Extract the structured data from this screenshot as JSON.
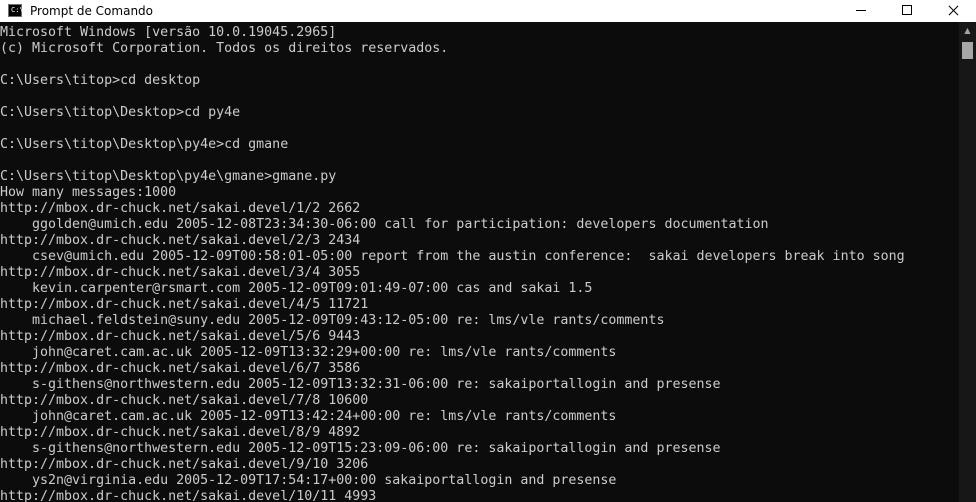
{
  "window": {
    "title": "Prompt de Comando",
    "icon_glyph": "C:\\"
  },
  "console": {
    "lines": [
      "Microsoft Windows [versão 10.0.19045.2965]",
      "(c) Microsoft Corporation. Todos os direitos reservados.",
      "",
      "C:\\Users\\titop>cd desktop",
      "",
      "C:\\Users\\titop\\Desktop>cd py4e",
      "",
      "C:\\Users\\titop\\Desktop\\py4e>cd gmane",
      "",
      "C:\\Users\\titop\\Desktop\\py4e\\gmane>gmane.py",
      "How many messages:1000",
      "http://mbox.dr-chuck.net/sakai.devel/1/2 2662",
      "    ggolden@umich.edu 2005-12-08T23:34:30-06:00 call for participation: developers documentation",
      "http://mbox.dr-chuck.net/sakai.devel/2/3 2434",
      "    csev@umich.edu 2005-12-09T00:58:01-05:00 report from the austin conference:  sakai developers break into song",
      "http://mbox.dr-chuck.net/sakai.devel/3/4 3055",
      "    kevin.carpenter@rsmart.com 2005-12-09T09:01:49-07:00 cas and sakai 1.5",
      "http://mbox.dr-chuck.net/sakai.devel/4/5 11721",
      "    michael.feldstein@suny.edu 2005-12-09T09:43:12-05:00 re: lms/vle rants/comments",
      "http://mbox.dr-chuck.net/sakai.devel/5/6 9443",
      "    john@caret.cam.ac.uk 2005-12-09T13:32:29+00:00 re: lms/vle rants/comments",
      "http://mbox.dr-chuck.net/sakai.devel/6/7 3586",
      "    s-githens@northwestern.edu 2005-12-09T13:32:31-06:00 re: sakaiportallogin and presense",
      "http://mbox.dr-chuck.net/sakai.devel/7/8 10600",
      "    john@caret.cam.ac.uk 2005-12-09T13:42:24+00:00 re: lms/vle rants/comments",
      "http://mbox.dr-chuck.net/sakai.devel/8/9 4892",
      "    s-githens@northwestern.edu 2005-12-09T15:23:09-06:00 re: sakaiportallogin and presense",
      "http://mbox.dr-chuck.net/sakai.devel/9/10 3206",
      "    ys2n@virginia.edu 2005-12-09T17:54:17+00:00 sakaiportallogin and presense",
      "http://mbox.dr-chuck.net/sakai.devel/10/11 4993"
    ]
  },
  "colors": {
    "background": "#0c0c0c",
    "foreground": "#cccccc",
    "titlebar": "#ffffff",
    "scrollbar_track": "#171717",
    "scrollbar_thumb": "#a6a6a6"
  },
  "icons": {
    "app": "cmd-icon",
    "minimize": "minimize-icon",
    "maximize": "maximize-icon",
    "close": "close-icon",
    "scroll_up": "scroll-up-arrow-icon"
  }
}
